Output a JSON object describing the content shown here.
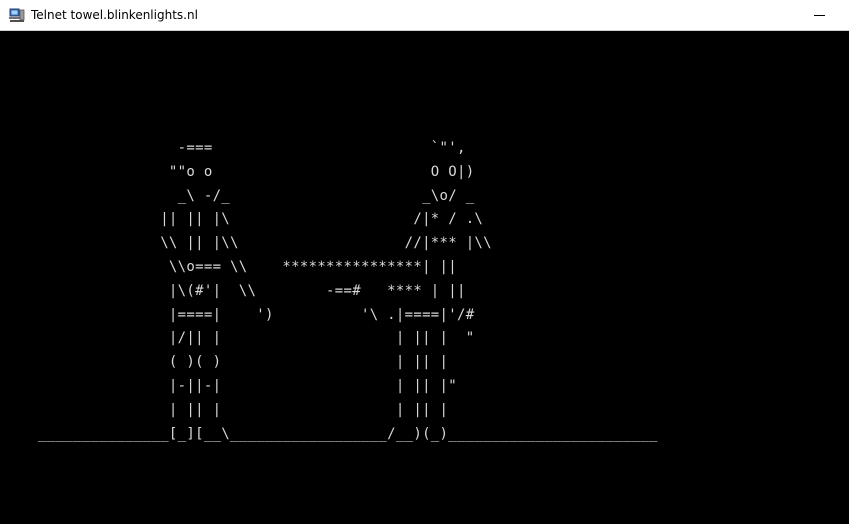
{
  "window": {
    "title": "Telnet towel.blinkenlights.nl",
    "icon": "telnet-terminal-icon",
    "minimize_glyph": "minimize-icon"
  },
  "terminal": {
    "background": "#000000",
    "foreground": "#d8d8d8",
    "lines": [
      "                -===                         `\"',",
      "               \"\"o o                         O O|)",
      "                _\\ -/_                      _\\o/ _",
      "              || || |\\                     /|* / .\\",
      "              \\\\ || |\\\\                   //|*** |\\\\",
      "               \\\\o=== \\\\    ****************| ||",
      "               |\\(#'|  \\\\        -==#   **** | ||",
      "               |====|    ')          '\\ .|====|'/#",
      "               |/|| |                    | || |  \"",
      "               ( )( )                    | || |",
      "               |-||-|                    | || |\"",
      "               | || |                    | || |",
      "_______________[_][__\\__________________/__)(_)________________________"
    ]
  }
}
